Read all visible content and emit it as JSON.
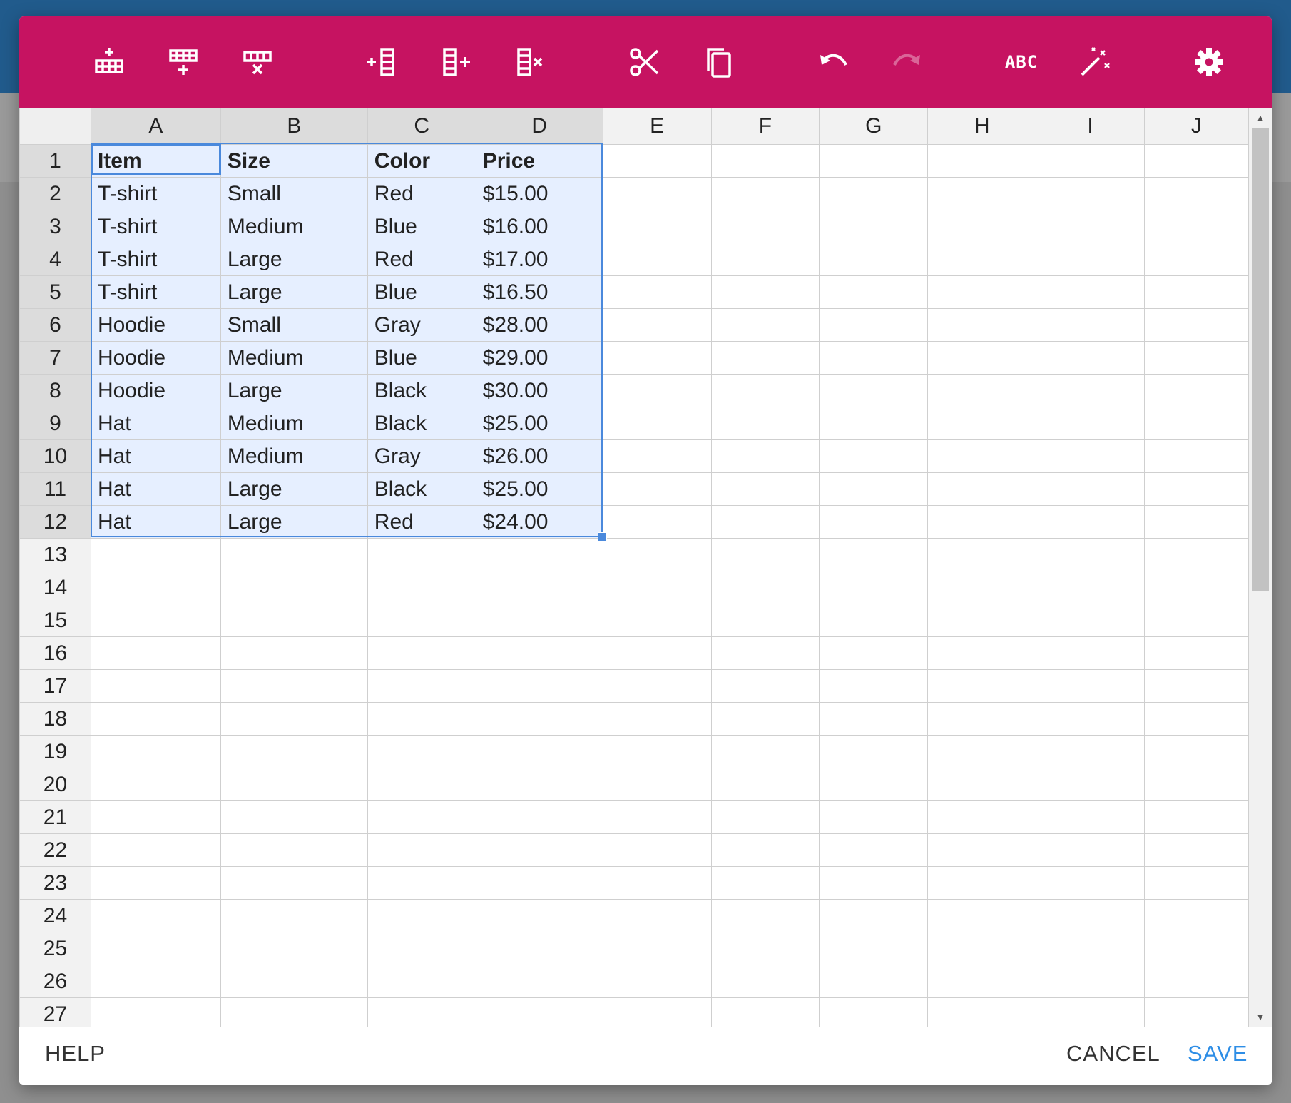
{
  "toolbar": {
    "color": "#c61361",
    "buttons": [
      {
        "name": "insert-row-above-icon",
        "label": "Insert row above",
        "enabled": true
      },
      {
        "name": "insert-row-below-icon",
        "label": "Insert row below",
        "enabled": true
      },
      {
        "name": "delete-row-icon",
        "label": "Delete row",
        "enabled": true
      },
      {
        "name": "insert-column-left-icon",
        "label": "Insert column left",
        "enabled": true
      },
      {
        "name": "insert-column-right-icon",
        "label": "Insert column right",
        "enabled": true
      },
      {
        "name": "delete-column-icon",
        "label": "Delete column",
        "enabled": true
      },
      {
        "name": "cut-icon",
        "label": "Cut",
        "enabled": true
      },
      {
        "name": "copy-icon",
        "label": "Copy",
        "enabled": true
      },
      {
        "name": "undo-icon",
        "label": "Undo",
        "enabled": true
      },
      {
        "name": "redo-icon",
        "label": "Redo",
        "enabled": false
      },
      {
        "name": "spellcheck-icon",
        "label": "ABC",
        "enabled": true
      },
      {
        "name": "magic-wand-icon",
        "label": "Auto format",
        "enabled": true
      },
      {
        "name": "settings-icon",
        "label": "Settings",
        "enabled": true
      }
    ]
  },
  "sheet": {
    "columns": [
      "A",
      "B",
      "C",
      "D",
      "E",
      "F",
      "G",
      "H",
      "I",
      "J"
    ],
    "selected_columns": [
      "A",
      "B",
      "C",
      "D"
    ],
    "selected_rows": [
      1,
      2,
      3,
      4,
      5,
      6,
      7,
      8,
      9,
      10,
      11,
      12
    ],
    "row_numbers": [
      "1",
      "2",
      "3",
      "4",
      "5",
      "6",
      "7",
      "8",
      "9",
      "10",
      "11",
      "12",
      "13",
      "14",
      "15",
      "16",
      "17",
      "18",
      "19",
      "20",
      "21",
      "22",
      "23",
      "24",
      "25",
      "26",
      "27"
    ],
    "rows": [
      [
        "Item",
        "Size",
        "Color",
        "Price"
      ],
      [
        "T-shirt",
        "Small",
        "Red",
        "$15.00"
      ],
      [
        "T-shirt",
        "Medium",
        "Blue",
        "$16.00"
      ],
      [
        "T-shirt",
        "Large",
        "Red",
        "$17.00"
      ],
      [
        "T-shirt",
        "Large",
        "Blue",
        "$16.50"
      ],
      [
        "Hoodie",
        "Small",
        "Gray",
        "$28.00"
      ],
      [
        "Hoodie",
        "Medium",
        "Blue",
        "$29.00"
      ],
      [
        "Hoodie",
        "Large",
        "Black",
        "$30.00"
      ],
      [
        "Hat",
        "Medium",
        "Black",
        "$25.00"
      ],
      [
        "Hat",
        "Medium",
        "Gray",
        "$26.00"
      ],
      [
        "Hat",
        "Large",
        "Black",
        "$25.00"
      ],
      [
        "Hat",
        "Large",
        "Red",
        "$24.00"
      ]
    ],
    "active_cell": "A1",
    "selection_color": "#4a89dc"
  },
  "footer": {
    "help_label": "HELP",
    "cancel_label": "CANCEL",
    "save_label": "SAVE",
    "save_color": "#2e8ee6"
  }
}
